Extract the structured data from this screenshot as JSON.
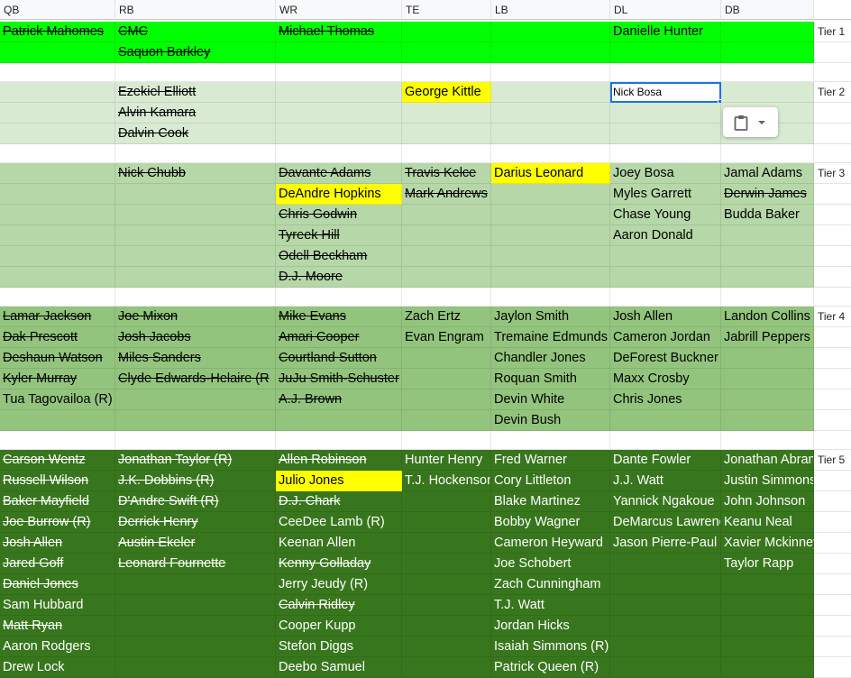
{
  "columns": [
    "QB",
    "RB",
    "WR",
    "TE",
    "LB",
    "DL",
    "DB"
  ],
  "colors": {
    "tier1": "#00ff00",
    "tier2": "#d9ead3",
    "tier3": "#b6d7a8",
    "tier4": "#93c47d",
    "tier5": "#38761d",
    "highlight": "#ffff00",
    "selection": "#1a73e8"
  },
  "rows": [
    {
      "bg": "tier1",
      "tier": "Tier 1",
      "cells": [
        {
          "t": "Patrick Mahomes",
          "s": true
        },
        {
          "t": "CMC",
          "s": true
        },
        {
          "t": "Michael Thomas",
          "s": true
        },
        {
          "t": ""
        },
        {
          "t": ""
        },
        {
          "t": "Danielle Hunter"
        },
        {
          "t": ""
        }
      ]
    },
    {
      "bg": "tier1",
      "cells": [
        {
          "t": ""
        },
        {
          "t": "Saquon Barkley",
          "s": true
        },
        {
          "t": ""
        },
        {
          "t": ""
        },
        {
          "t": ""
        },
        {
          "t": ""
        },
        {
          "t": ""
        }
      ]
    },
    {
      "bg": "white",
      "cells": [
        {
          "t": ""
        },
        {
          "t": ""
        },
        {
          "t": ""
        },
        {
          "t": ""
        },
        {
          "t": ""
        },
        {
          "t": ""
        },
        {
          "t": ""
        }
      ]
    },
    {
      "bg": "tier2",
      "tier": "Tier 2",
      "cells": [
        {
          "t": ""
        },
        {
          "t": "Ezekiel Elliott",
          "s": true
        },
        {
          "t": ""
        },
        {
          "t": "George Kittle",
          "h": true
        },
        {
          "t": ""
        },
        {
          "t": "Nick Bosa",
          "sel": true
        },
        {
          "t": ""
        }
      ]
    },
    {
      "bg": "tier2",
      "cells": [
        {
          "t": ""
        },
        {
          "t": "Alvin Kamara",
          "s": true
        },
        {
          "t": ""
        },
        {
          "t": ""
        },
        {
          "t": ""
        },
        {
          "t": ""
        },
        {
          "t": ""
        }
      ]
    },
    {
      "bg": "tier2",
      "cells": [
        {
          "t": ""
        },
        {
          "t": "Dalvin Cook",
          "s": true
        },
        {
          "t": ""
        },
        {
          "t": ""
        },
        {
          "t": ""
        },
        {
          "t": ""
        },
        {
          "t": ""
        }
      ]
    },
    {
      "bg": "white",
      "cells": [
        {
          "t": ""
        },
        {
          "t": ""
        },
        {
          "t": ""
        },
        {
          "t": ""
        },
        {
          "t": ""
        },
        {
          "t": ""
        },
        {
          "t": ""
        }
      ]
    },
    {
      "bg": "tier3",
      "tier": "Tier 3",
      "cells": [
        {
          "t": ""
        },
        {
          "t": "Nick Chubb",
          "s": true
        },
        {
          "t": "Davante Adams",
          "s": true
        },
        {
          "t": "Travis Kelce",
          "s": true
        },
        {
          "t": "Darius Leonard",
          "h": true
        },
        {
          "t": "Joey Bosa"
        },
        {
          "t": "Jamal Adams"
        }
      ]
    },
    {
      "bg": "tier3",
      "cells": [
        {
          "t": ""
        },
        {
          "t": ""
        },
        {
          "t": "DeAndre Hopkins",
          "h": true
        },
        {
          "t": "Mark Andrews",
          "s": true
        },
        {
          "t": ""
        },
        {
          "t": "Myles Garrett"
        },
        {
          "t": "Derwin James",
          "s": true
        }
      ]
    },
    {
      "bg": "tier3",
      "cells": [
        {
          "t": ""
        },
        {
          "t": ""
        },
        {
          "t": "Chris Godwin",
          "s": true
        },
        {
          "t": ""
        },
        {
          "t": ""
        },
        {
          "t": "Chase Young"
        },
        {
          "t": "Budda Baker"
        }
      ]
    },
    {
      "bg": "tier3",
      "cells": [
        {
          "t": ""
        },
        {
          "t": ""
        },
        {
          "t": "Tyreek Hill",
          "s": true
        },
        {
          "t": ""
        },
        {
          "t": ""
        },
        {
          "t": "Aaron Donald"
        },
        {
          "t": ""
        }
      ]
    },
    {
      "bg": "tier3",
      "cells": [
        {
          "t": ""
        },
        {
          "t": ""
        },
        {
          "t": "Odell Beckham",
          "s": true
        },
        {
          "t": ""
        },
        {
          "t": ""
        },
        {
          "t": ""
        },
        {
          "t": ""
        }
      ]
    },
    {
      "bg": "tier3",
      "cells": [
        {
          "t": ""
        },
        {
          "t": ""
        },
        {
          "t": "D.J. Moore",
          "s": true
        },
        {
          "t": ""
        },
        {
          "t": ""
        },
        {
          "t": ""
        },
        {
          "t": ""
        }
      ]
    },
    {
      "bg": "white",
      "cells": [
        {
          "t": ""
        },
        {
          "t": ""
        },
        {
          "t": ""
        },
        {
          "t": ""
        },
        {
          "t": ""
        },
        {
          "t": ""
        },
        {
          "t": ""
        }
      ]
    },
    {
      "bg": "tier4",
      "tier": "Tier 4",
      "cells": [
        {
          "t": "Lamar Jackson",
          "s": true
        },
        {
          "t": "Joe Mixon",
          "s": true
        },
        {
          "t": "Mike Evans",
          "s": true
        },
        {
          "t": "Zach Ertz"
        },
        {
          "t": "Jaylon Smith"
        },
        {
          "t": "Josh Allen"
        },
        {
          "t": "Landon Collins"
        }
      ]
    },
    {
      "bg": "tier4",
      "cells": [
        {
          "t": "Dak Prescott",
          "s": true
        },
        {
          "t": "Josh Jacobs",
          "s": true
        },
        {
          "t": "Amari Cooper",
          "s": true
        },
        {
          "t": "Evan Engram"
        },
        {
          "t": "Tremaine Edmunds"
        },
        {
          "t": "Cameron Jordan"
        },
        {
          "t": "Jabrill Peppers"
        }
      ]
    },
    {
      "bg": "tier4",
      "cells": [
        {
          "t": "Deshaun Watson",
          "s": true
        },
        {
          "t": "Miles Sanders",
          "s": true
        },
        {
          "t": "Courtland Sutton",
          "s": true
        },
        {
          "t": ""
        },
        {
          "t": "Chandler Jones"
        },
        {
          "t": "DeForest Buckner"
        },
        {
          "t": ""
        }
      ]
    },
    {
      "bg": "tier4",
      "cells": [
        {
          "t": "Kyler Murray",
          "s": true
        },
        {
          "t": "Clyde Edwards-Helaire (R",
          "s": true
        },
        {
          "t": "JuJu Smith-Schuster",
          "s": true
        },
        {
          "t": ""
        },
        {
          "t": "Roquan Smith"
        },
        {
          "t": "Maxx Crosby"
        },
        {
          "t": ""
        }
      ]
    },
    {
      "bg": "tier4",
      "cells": [
        {
          "t": "Tua Tagovailoa (R)"
        },
        {
          "t": ""
        },
        {
          "t": "A.J. Brown",
          "s": true
        },
        {
          "t": ""
        },
        {
          "t": "Devin White"
        },
        {
          "t": "Chris Jones"
        },
        {
          "t": ""
        }
      ]
    },
    {
      "bg": "tier4",
      "cells": [
        {
          "t": ""
        },
        {
          "t": ""
        },
        {
          "t": ""
        },
        {
          "t": ""
        },
        {
          "t": "Devin Bush"
        },
        {
          "t": ""
        },
        {
          "t": ""
        }
      ]
    },
    {
      "bg": "white",
      "cells": [
        {
          "t": ""
        },
        {
          "t": ""
        },
        {
          "t": ""
        },
        {
          "t": ""
        },
        {
          "t": ""
        },
        {
          "t": ""
        },
        {
          "t": ""
        }
      ]
    },
    {
      "bg": "tier5",
      "tier": "Tier 5",
      "cells": [
        {
          "t": "Carson Wentz",
          "s": true
        },
        {
          "t": "Jonathan Taylor (R)",
          "s": true
        },
        {
          "t": "Allen Robinson",
          "s": true
        },
        {
          "t": "Hunter Henry"
        },
        {
          "t": "Fred Warner"
        },
        {
          "t": "Dante Fowler"
        },
        {
          "t": "Jonathan Abram"
        }
      ]
    },
    {
      "bg": "tier5",
      "cells": [
        {
          "t": "Russell Wilson",
          "s": true
        },
        {
          "t": "J.K. Dobbins (R)",
          "s": true
        },
        {
          "t": "Julio Jones",
          "h": true
        },
        {
          "t": "T.J. Hockenson"
        },
        {
          "t": "Cory Littleton"
        },
        {
          "t": "J.J. Watt"
        },
        {
          "t": "Justin Simmons"
        }
      ]
    },
    {
      "bg": "tier5",
      "cells": [
        {
          "t": "Baker Mayfield",
          "s": true
        },
        {
          "t": "D'Andre Swift (R)",
          "s": true
        },
        {
          "t": "D.J. Chark",
          "s": true
        },
        {
          "t": ""
        },
        {
          "t": "Blake Martinez"
        },
        {
          "t": "Yannick Ngakoue"
        },
        {
          "t": "John Johnson"
        }
      ]
    },
    {
      "bg": "tier5",
      "cells": [
        {
          "t": "Joe Burrow (R)",
          "s": true
        },
        {
          "t": "Derrick Henry",
          "s": true
        },
        {
          "t": "CeeDee Lamb (R)"
        },
        {
          "t": ""
        },
        {
          "t": "Bobby Wagner"
        },
        {
          "t": "DeMarcus Lawrence"
        },
        {
          "t": "Keanu Neal"
        }
      ]
    },
    {
      "bg": "tier5",
      "cells": [
        {
          "t": "Josh Allen",
          "s": true
        },
        {
          "t": "Austin Ekeler",
          "s": true
        },
        {
          "t": "Keenan Allen"
        },
        {
          "t": ""
        },
        {
          "t": "Cameron Heyward"
        },
        {
          "t": "Jason Pierre-Paul"
        },
        {
          "t": "Xavier Mckinney (R)",
          "o": true
        }
      ]
    },
    {
      "bg": "tier5",
      "cells": [
        {
          "t": "Jared Goff",
          "s": true
        },
        {
          "t": "Leonard Fournette",
          "s": true
        },
        {
          "t": "Kenny Golladay",
          "s": true
        },
        {
          "t": ""
        },
        {
          "t": "Joe Schobert"
        },
        {
          "t": ""
        },
        {
          "t": "Taylor Rapp"
        }
      ]
    },
    {
      "bg": "tier5",
      "cells": [
        {
          "t": "Daniel Jones",
          "s": true
        },
        {
          "t": ""
        },
        {
          "t": "Jerry Jeudy (R)"
        },
        {
          "t": ""
        },
        {
          "t": "Zach Cunningham"
        },
        {
          "t": ""
        },
        {
          "t": ""
        }
      ]
    },
    {
      "bg": "tier5",
      "cells": [
        {
          "t": "Sam Hubbard"
        },
        {
          "t": ""
        },
        {
          "t": "Calvin Ridley",
          "s": true
        },
        {
          "t": ""
        },
        {
          "t": "T.J. Watt"
        },
        {
          "t": ""
        },
        {
          "t": ""
        }
      ]
    },
    {
      "bg": "tier5",
      "cells": [
        {
          "t": "Matt Ryan",
          "s": true
        },
        {
          "t": ""
        },
        {
          "t": "Cooper Kupp"
        },
        {
          "t": ""
        },
        {
          "t": "Jordan Hicks"
        },
        {
          "t": ""
        },
        {
          "t": ""
        }
      ]
    },
    {
      "bg": "tier5",
      "cells": [
        {
          "t": "Aaron Rodgers"
        },
        {
          "t": ""
        },
        {
          "t": "Stefon Diggs"
        },
        {
          "t": ""
        },
        {
          "t": "Isaiah Simmons (R)"
        },
        {
          "t": ""
        },
        {
          "t": ""
        }
      ]
    },
    {
      "bg": "tier5",
      "cells": [
        {
          "t": "Drew Lock"
        },
        {
          "t": ""
        },
        {
          "t": "Deebo Samuel"
        },
        {
          "t": ""
        },
        {
          "t": "Patrick Queen (R)"
        },
        {
          "t": ""
        },
        {
          "t": ""
        }
      ]
    }
  ],
  "paste_menu": {
    "icon": "clipboard-icon",
    "dropdown_icon": "caret-down-icon"
  }
}
